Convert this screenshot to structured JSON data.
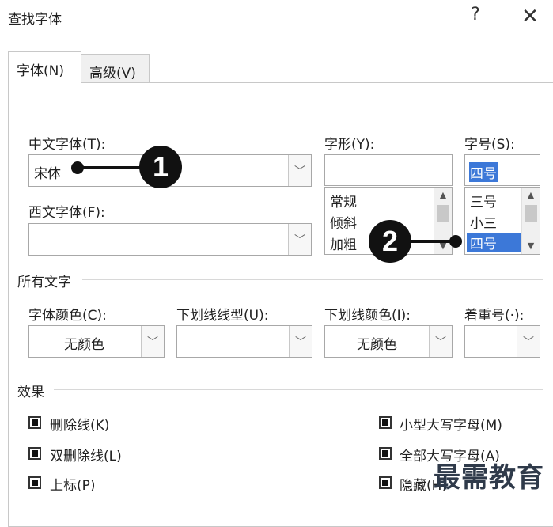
{
  "window": {
    "title": "查找字体",
    "help_label": "?",
    "close_label": "✕"
  },
  "tabs": [
    {
      "label": "字体(N)"
    },
    {
      "label": "高级(V)"
    }
  ],
  "chinese_font": {
    "label": "中文字体(T):",
    "value": "宋体"
  },
  "western_font": {
    "label": "西文字体(F):",
    "value": ""
  },
  "font_style": {
    "label": "字形(Y):",
    "value": "",
    "options": [
      "常规",
      "倾斜",
      "加粗"
    ]
  },
  "font_size": {
    "label": "字号(S):",
    "value": "四号",
    "options": [
      "三号",
      "小三",
      "四号"
    ],
    "selected": "四号"
  },
  "all_text": {
    "section_title": "所有文字",
    "font_color": {
      "label": "字体颜色(C):",
      "value": "无颜色"
    },
    "underline_style": {
      "label": "下划线线型(U):",
      "value": ""
    },
    "underline_color": {
      "label": "下划线颜色(I):",
      "value": "无颜色"
    },
    "emphasis_mark": {
      "label": "着重号(·):",
      "value": ""
    }
  },
  "effects": {
    "section_title": "效果",
    "left": [
      {
        "label": "删除线(K)"
      },
      {
        "label": "双删除线(L)"
      },
      {
        "label": "上标(P)"
      }
    ],
    "right": [
      {
        "label": "小型大写字母(M)"
      },
      {
        "label": "全部大写字母(A)"
      },
      {
        "label": "隐藏(H)"
      }
    ]
  },
  "callouts": [
    "1",
    "2"
  ],
  "watermark": "最需教育",
  "icons": {
    "dropdown": "chevron-down-icon",
    "scroll_up": "scroll-up-icon",
    "scroll_down": "scroll-down-icon",
    "checkbox": "checkbox-indeterminate-icon"
  }
}
